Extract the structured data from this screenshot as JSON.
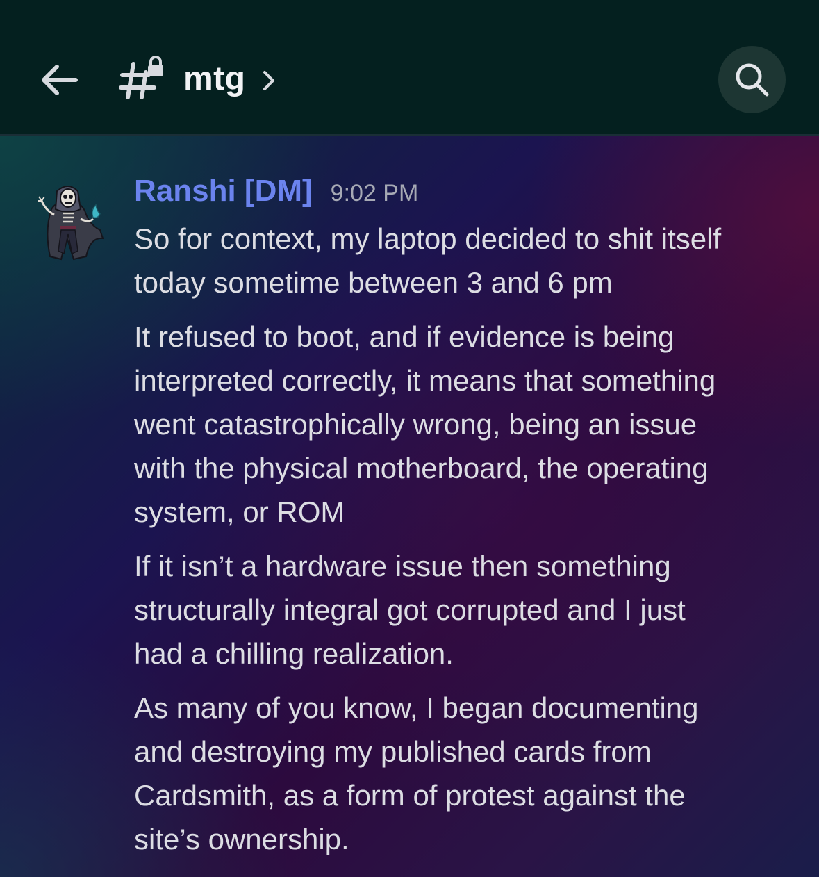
{
  "header": {
    "channel_name": "mtg",
    "icons": {
      "back": "arrow-left-icon",
      "channel": "locked-hashtag-icon",
      "chevron": "chevron-right-icon",
      "search": "search-icon"
    }
  },
  "message": {
    "author": "Ranshi [DM]",
    "author_color": "#6b83ee",
    "timestamp": "9:02 PM",
    "avatar": "skeleton-mage-avatar",
    "lines": [
      "So for context, my laptop decided to shit itself\ntoday sometime between 3 and 6 pm",
      "It refused to boot, and if evidence is being\ninterpreted correctly, it means that something\nwent catastrophically wrong, being an issue\nwith the physical motherboard, the operating\nsystem, or ROM",
      "If it isn’t a hardware issue then something\nstructurally integral got corrupted and I just\nhad a chilling realization.",
      "As many of you know, I began documenting\nand destroying my published cards from\nCardsmith, as a form of protest against the\nsite’s ownership."
    ]
  }
}
